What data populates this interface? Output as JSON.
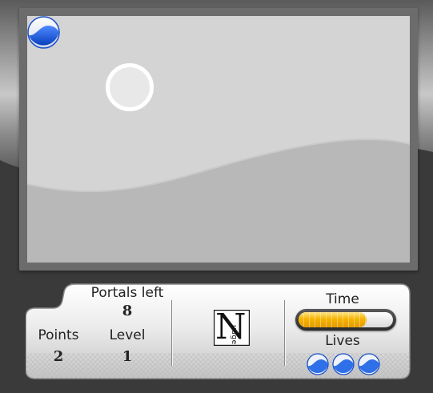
{
  "hud": {
    "portals_left_label": "Portals left",
    "portals_left_value": "8",
    "points_label": "Points",
    "points_value": "2",
    "level_label": "Level",
    "level_value": "1",
    "time_label": "Time",
    "time_remaining_fraction": 0.72,
    "lives_label": "Lives",
    "lives_count": 3
  },
  "logo": {
    "letter": "N",
    "rest": "udge"
  },
  "colors": {
    "ball_blue": "#1a5fe0",
    "time_fill": "#f5b400",
    "field_bg": "#d4d4d4",
    "field_frame": "#6c6c6c"
  }
}
